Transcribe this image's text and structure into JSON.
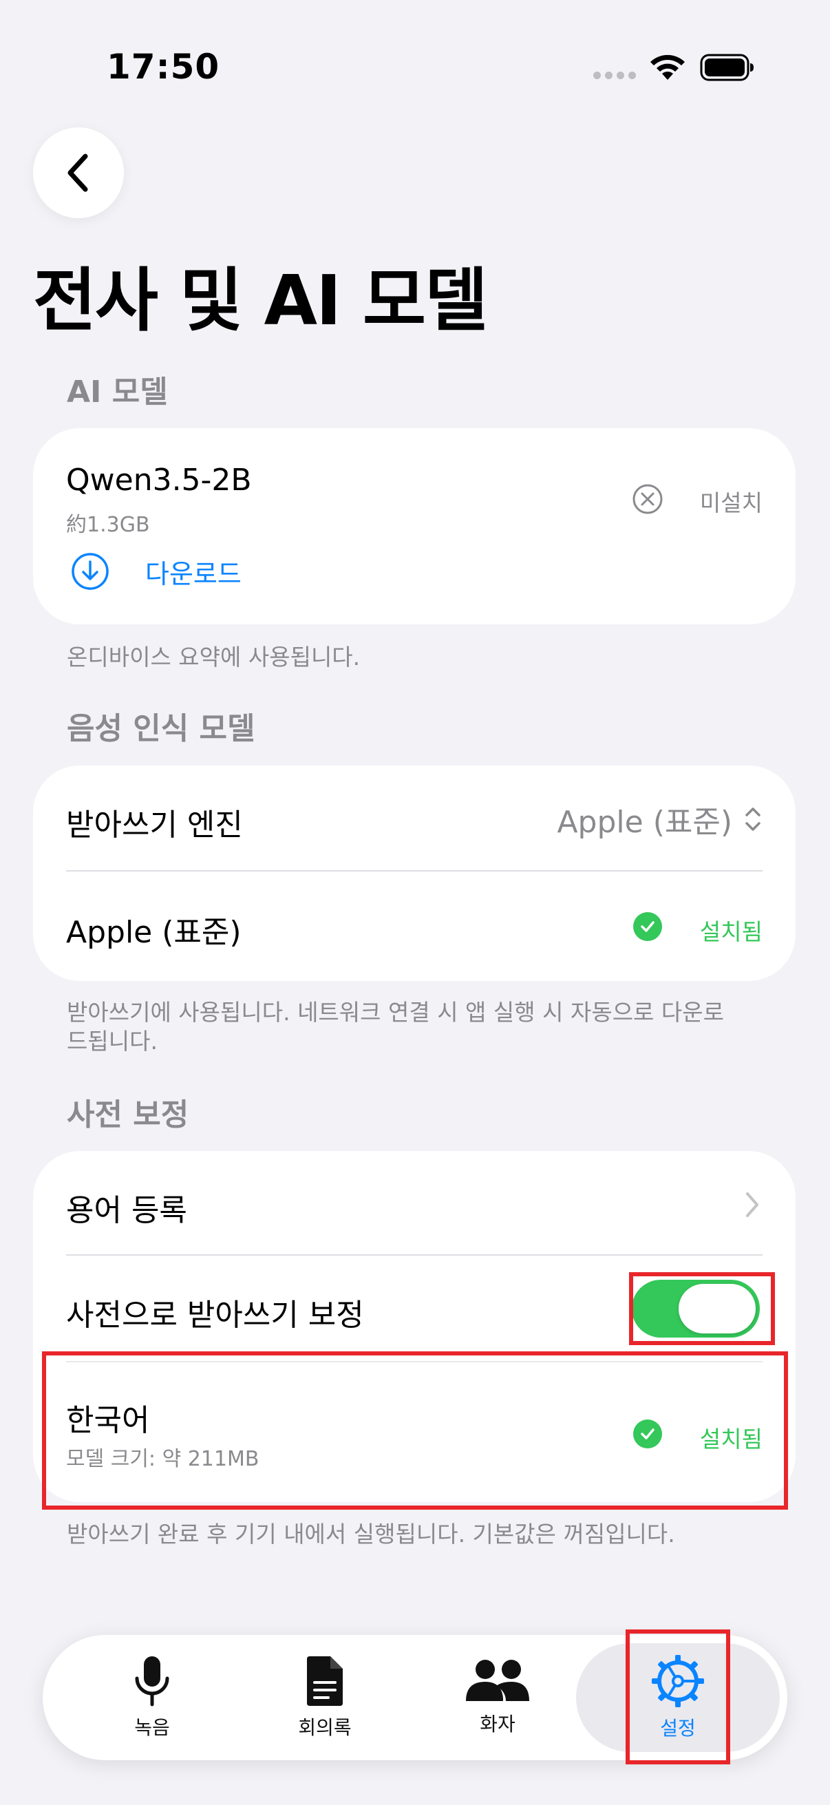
{
  "status_bar": {
    "time": "17:50"
  },
  "header": {
    "title": "전사 및 AI 모델"
  },
  "ai_model_section": {
    "header": "AI 모델",
    "model_name": "Qwen3.5-2B",
    "model_size": "約1.3GB",
    "status": "미설치",
    "download_label": "다운로드",
    "footnote": "온디바이스 요약에 사용됩니다."
  },
  "speech_section": {
    "header": "음성 인식 모델",
    "engine_label": "받아쓰기 엔진",
    "engine_value": "Apple (표준)",
    "installed_name": "Apple (표준)",
    "installed_status": "설치됨",
    "footnote": "받아쓰기에 사용됩니다. 네트워크 연결 시 앱 실행 시 자동으로 다운로드됩니다."
  },
  "dictionary_section": {
    "header": "사전 보정",
    "terms_label": "용어 등록",
    "toggle_label": "사전으로 받아쓰기 보정",
    "toggle_on": true,
    "language_name": "한국어",
    "language_size": "모델 크기: 약 211MB",
    "language_status": "설치됨",
    "footnote": "받아쓰기 완료 후 기기 내에서 실행됩니다. 기본값은 꺼짐입니다."
  },
  "tabbar": {
    "tabs": [
      {
        "label": "녹음",
        "icon": "microphone-icon"
      },
      {
        "label": "회의록",
        "icon": "document-icon"
      },
      {
        "label": "화자",
        "icon": "people-icon"
      },
      {
        "label": "설정",
        "icon": "gear-icon"
      }
    ],
    "active_index": 3
  },
  "colors": {
    "accent": "#0a84ff",
    "success": "#34c759",
    "highlight_box": "#e8262a",
    "background": "#f2f2f7"
  }
}
